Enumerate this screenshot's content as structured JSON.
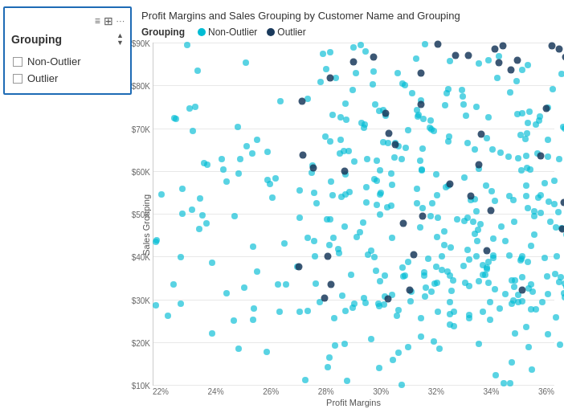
{
  "leftPanel": {
    "title": "Grouping",
    "filterItems": [
      {
        "label": "Non-Outlier",
        "checked": false
      },
      {
        "label": "Outlier",
        "checked": false
      }
    ]
  },
  "chart": {
    "title": "Profit Margins and Sales Grouping by Customer Name and Grouping",
    "legend": {
      "groupingLabel": "Grouping",
      "items": [
        {
          "label": "Non-Outlier",
          "color": "#00BCD4"
        },
        {
          "label": "Outlier",
          "color": "#1a3a5c"
        }
      ]
    },
    "yAxis": {
      "label": "Sales Grouping",
      "ticks": [
        "$90K",
        "$80K",
        "$70K",
        "$60K",
        "$50K",
        "$40K",
        "$30K",
        "$20K",
        "$10K"
      ]
    },
    "xAxis": {
      "label": "Profit Margins",
      "ticks": [
        "22%",
        "24%",
        "26%",
        "28%",
        "30%",
        "32%",
        "34%",
        "36%"
      ]
    }
  },
  "icons": {
    "hamburger": "≡",
    "tile": "⊞",
    "ellipsis": "•••",
    "upArrow": "▲",
    "downArrow": "▼"
  }
}
